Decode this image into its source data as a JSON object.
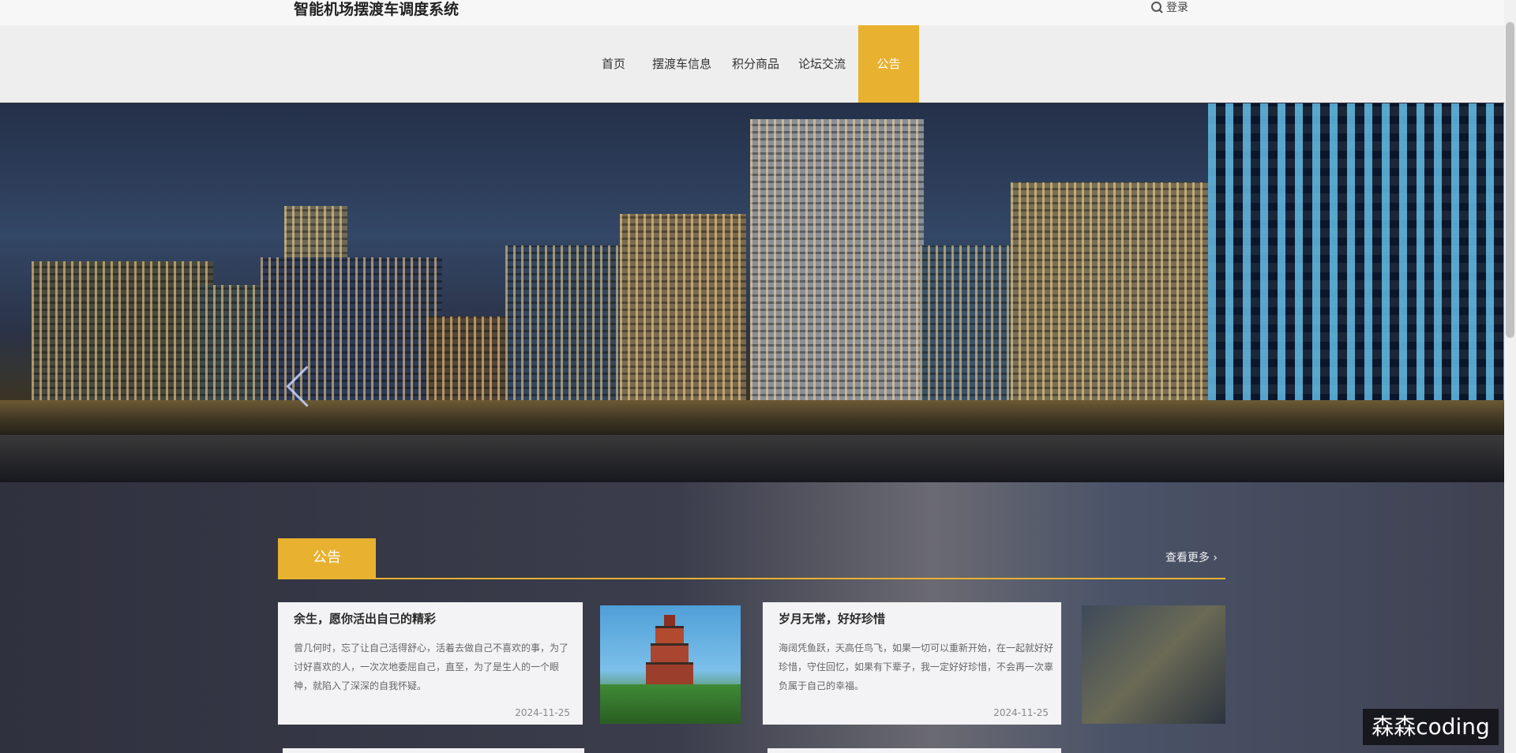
{
  "header": {
    "site_title": "智能机场摆渡车调度系统",
    "login_label": "登录"
  },
  "nav": {
    "items": [
      "首页",
      "摆渡车信息",
      "积分商品",
      "论坛交流"
    ],
    "active_label": "公告"
  },
  "notice": {
    "tab_label": "公告",
    "more_label": "查看更多 ›",
    "items": [
      {
        "title": "余生，愿你活出自己的精彩",
        "excerpt": "曾几何时，忘了让自己活得舒心，活着去做自己不喜欢的事，为了讨好喜欢的人，一次次地委屈自己，直至，为了是生人的一个眼神，就陷入了深深的自我怀疑。",
        "date": "2024-11-25"
      },
      {
        "title": "岁月无常，好好珍惜",
        "excerpt": "海阔凭鱼跃，天高任鸟飞，如果一切可以重新开始，在一起就好好珍惜，守住回忆，如果有下辈子，我一定好好珍惜，不会再一次辜负属于自己的幸福。",
        "date": "2024-11-25"
      }
    ]
  },
  "watermark": "森森coding",
  "colors": {
    "accent": "#e8b12f",
    "nav_bg": "#eeeeee",
    "content_bg": "#30313f"
  }
}
